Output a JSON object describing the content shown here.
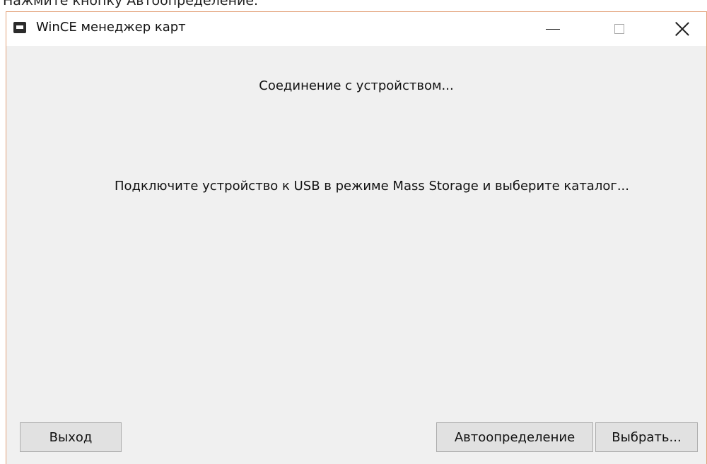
{
  "page": {
    "caption": "Нажмите кнопку Автоопределение."
  },
  "window": {
    "title": "WinCE менеджер карт",
    "icon": "app-icon",
    "caption_buttons": {
      "minimize_icon": "minimize-icon",
      "maximize_icon": "maximize-icon",
      "close_icon": "close-icon"
    }
  },
  "content": {
    "status": "Соединение с устройством...",
    "instruction": "Подключите устройство к USB в режиме Mass Storage и выберите каталог..."
  },
  "buttons": {
    "exit": "Выход",
    "autodetect": "Автоопределение",
    "select": "Выбрать..."
  },
  "colors": {
    "window_border": "#e3a27a",
    "window_background": "#f0f0f0",
    "button_face": "#e1e1e1"
  }
}
